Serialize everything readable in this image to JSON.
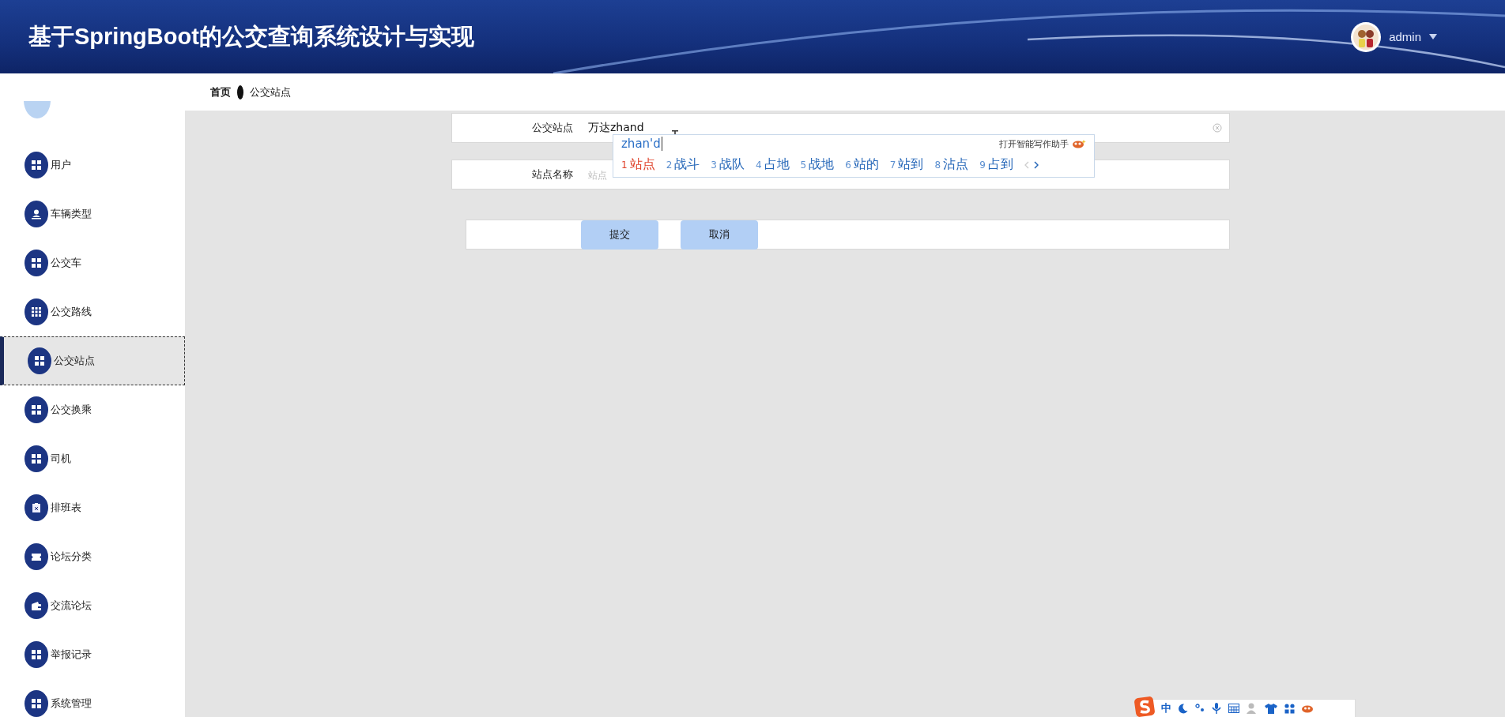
{
  "header": {
    "title": "基于SpringBoot的公交查询系统设计与实现",
    "user": "admin"
  },
  "breadcrumb": [
    {
      "label": "首页",
      "current": false
    },
    {
      "label": "公交站点",
      "current": true
    }
  ],
  "sidebar": {
    "items": [
      {
        "label": "用户",
        "kind": "grid",
        "selected": false
      },
      {
        "label": "车辆类型",
        "kind": "person",
        "selected": false
      },
      {
        "label": "公交车",
        "kind": "grid",
        "selected": false
      },
      {
        "label": "公交路线",
        "kind": "grid9",
        "selected": false
      },
      {
        "label": "公交站点",
        "kind": "grid",
        "selected": true
      },
      {
        "label": "公交换乘",
        "kind": "grid",
        "selected": false
      },
      {
        "label": "司机",
        "kind": "grid",
        "selected": false
      },
      {
        "label": "排班表",
        "kind": "clipboard",
        "selected": false
      },
      {
        "label": "论坛分类",
        "kind": "ticket",
        "selected": false
      },
      {
        "label": "交流论坛",
        "kind": "wallet",
        "selected": false
      },
      {
        "label": "举报记录",
        "kind": "grid",
        "selected": false
      },
      {
        "label": "系统管理",
        "kind": "grid",
        "selected": false
      }
    ]
  },
  "form": {
    "fields": [
      {
        "label": "公交站点",
        "value": "万达zhand"
      },
      {
        "label": "站点名称",
        "placeholder": "站点"
      }
    ],
    "buttons": [
      "提交",
      "取消"
    ]
  },
  "ime": {
    "composition": "zhan'd",
    "assistant": "打开智能写作助手",
    "candidates": [
      {
        "number": "1",
        "word": "站点",
        "selected": true
      },
      {
        "number": "2",
        "word": "战斗",
        "selected": false
      },
      {
        "number": "3",
        "word": "战队",
        "selected": false
      },
      {
        "number": "4",
        "word": "占地",
        "selected": false
      },
      {
        "number": "5",
        "word": "战地",
        "selected": false
      },
      {
        "number": "6",
        "word": "站的",
        "selected": false
      },
      {
        "number": "7",
        "word": "站到",
        "selected": false
      },
      {
        "number": "8",
        "word": "沾点",
        "selected": false
      },
      {
        "number": "9",
        "word": "占到",
        "selected": false
      }
    ],
    "toolbar_mode": "中"
  }
}
